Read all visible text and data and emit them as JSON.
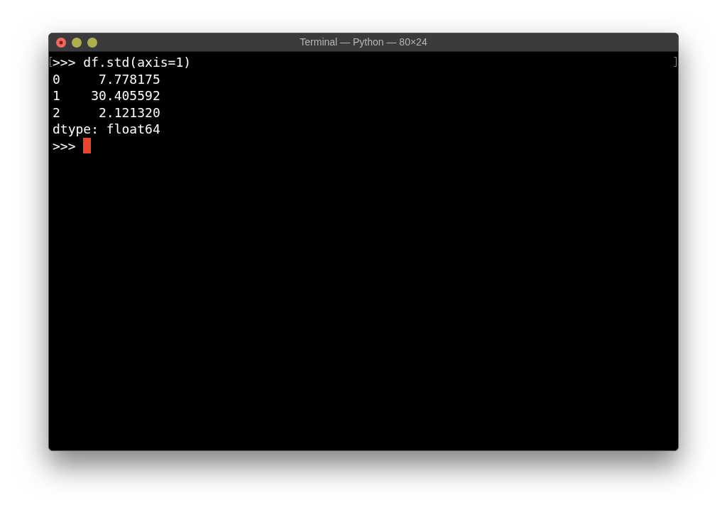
{
  "window": {
    "title": "Terminal — Python — 80×24"
  },
  "terminal": {
    "lines": [
      ">>> df.std(axis=1)",
      "0     7.778175",
      "1    30.405592",
      "2     2.121320",
      "dtype: float64"
    ],
    "prompt": ">>> ",
    "cursor": {
      "on": true
    }
  }
}
